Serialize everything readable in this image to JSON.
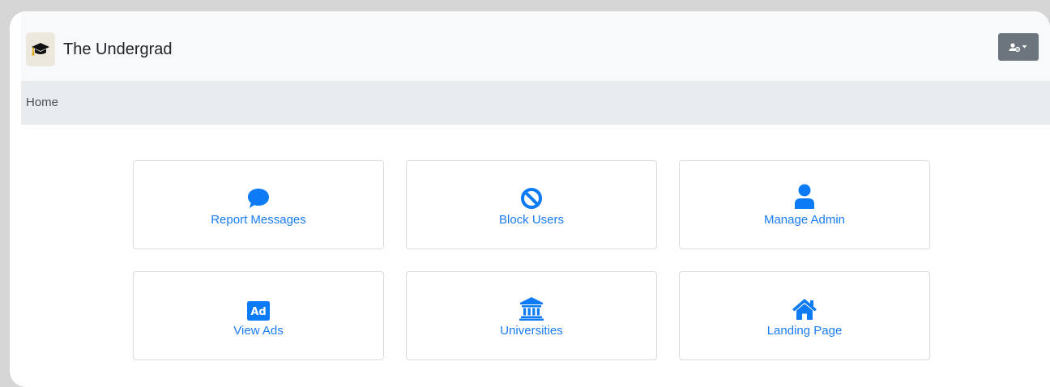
{
  "navbar": {
    "brand_name": "The Undergrad",
    "brand_icon": "graduation-cap-icon",
    "admin_menu_icon": "user-cog-icon"
  },
  "breadcrumb": {
    "items": [
      "Home"
    ]
  },
  "colors": {
    "accent": "#1a7cf4",
    "navbar_bg": "#f8f9fa",
    "breadcrumb_bg": "#e9ecef",
    "admin_button_bg": "#6c757d"
  },
  "cards": [
    {
      "label": "Report Messages",
      "icon": "speech-bubble-icon"
    },
    {
      "label": "Block Users",
      "icon": "ban-icon"
    },
    {
      "label": "Manage Admin",
      "icon": "user-icon"
    },
    {
      "label": "View Ads",
      "icon": "ad-icon"
    },
    {
      "label": "Universities",
      "icon": "university-icon"
    },
    {
      "label": "Landing Page",
      "icon": "home-icon"
    }
  ]
}
